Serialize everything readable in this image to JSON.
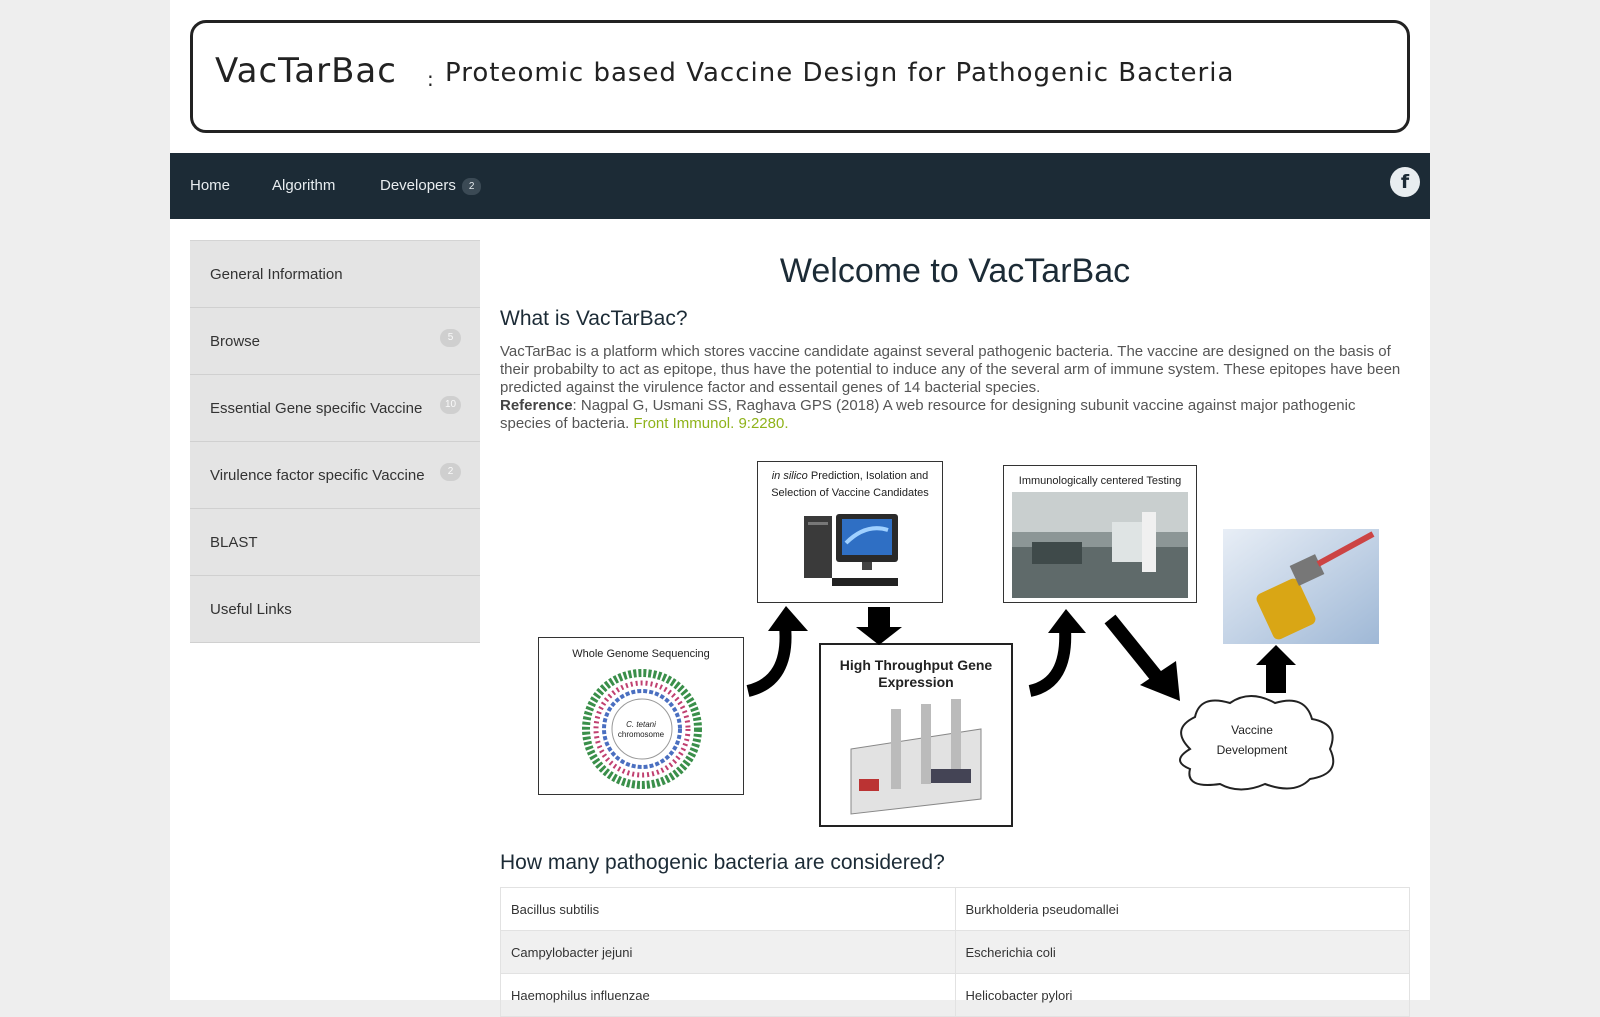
{
  "banner": {
    "title": "VacTarBac",
    "separator": ":",
    "subtitle": "Proteomic based Vaccine Design for Pathogenic Bacteria"
  },
  "nav": {
    "items": [
      {
        "label": "Home"
      },
      {
        "label": "Algorithm"
      },
      {
        "label": "Developers",
        "badge": "2"
      }
    ],
    "social_icon": "facebook-icon",
    "social_glyph": "f"
  },
  "sidebar": {
    "items": [
      {
        "label": "General Information",
        "badge": ""
      },
      {
        "label": "Browse",
        "badge": "5"
      },
      {
        "label": "Essential Gene specific Vaccine",
        "badge": "10"
      },
      {
        "label": "Virulence factor specific Vaccine",
        "badge": "2"
      },
      {
        "label": "BLAST",
        "badge": ""
      },
      {
        "label": "Useful Links",
        "badge": ""
      }
    ]
  },
  "main": {
    "welcome": "Welcome to VacTarBac",
    "what_heading": "What is VacTarBac?",
    "description": "VacTarBac is a platform which stores vaccine candidate against several pathogenic bacteria. The vaccine are designed on the basis of their probabilty to act as epitope, thus have the potential to induce any of the several arm of immune system. These epitopes have been predicted against the virulence factor and essentail genes of 14 bacterial species.",
    "reference_label": "Reference",
    "reference_text": ": Nagpal G, Usmani SS, Raghava GPS (2018) A web resource for designing subunit vaccine against major pathogenic species of bacteria.",
    "reference_link": "Front Immunol. 9:2280.",
    "diagram": {
      "insilico_italic": "in silico",
      "insilico_rest": "Prediction, Isolation and",
      "insilico_line2": "Selection of Vaccine Candidates",
      "immuno": "Immunologically centered Testing",
      "genome": "Whole Genome Sequencing",
      "chromosome_line1": "C. tetani",
      "chromosome_line2": "chromosome",
      "htge_line1": "High Throughput Gene",
      "htge_line2": "Expression",
      "vaccine_line1": "Vaccine",
      "vaccine_line2": "Development"
    },
    "species_heading": "How many pathogenic bacteria are considered?",
    "species_rows": [
      [
        "Bacillus subtilis",
        "Burkholderia pseudomallei"
      ],
      [
        "Campylobacter jejuni",
        "Escherichia coli"
      ],
      [
        "Haemophilus influenzae",
        "Helicobacter pylori"
      ]
    ]
  },
  "colors": {
    "nav_bg": "#1c2b36",
    "link_green": "#8fb31a",
    "sidebar_bg": "#e4e4e4"
  }
}
